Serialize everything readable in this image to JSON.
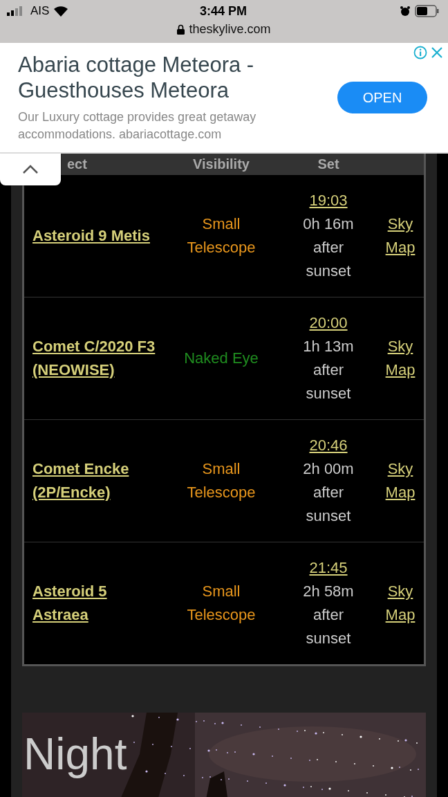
{
  "status_bar": {
    "carrier": "AIS",
    "time": "3:44 PM",
    "url": "theskylive.com"
  },
  "ad": {
    "title": "Abaria cottage Meteora - Guesthouses Meteora",
    "description": "Our Luxury cottage provides great getaway accommodations. abariacottage.com",
    "button": "OPEN"
  },
  "table": {
    "columns": [
      "ect",
      "Visibility",
      "Set"
    ],
    "rows": [
      {
        "object": "Asteroid 9 Metis",
        "visibility": "Small Telescope",
        "color": "#e8961c",
        "set_time": "19:03",
        "set_note": "0h 16m after sunset",
        "sky_map": "Sky Map"
      },
      {
        "object": "Comet C/2020 F3 (NEOWISE)",
        "visibility": "Naked Eye",
        "color": "#1f8c1f",
        "set_time": "20:00",
        "set_note": "1h 13m after sunset",
        "sky_map": "Sky Map"
      },
      {
        "object": "Comet Encke (2P/Encke)",
        "visibility": "Small Telescope",
        "color": "#e8961c",
        "set_time": "20:46",
        "set_note": "2h 00m after sunset",
        "sky_map": "Sky Map"
      },
      {
        "object": "Asteroid 5 Astraea",
        "visibility": "Small Telescope",
        "color": "#e8961c",
        "set_time": "21:45",
        "set_note": "2h 58m after sunset",
        "sky_map": "Sky Map"
      }
    ]
  },
  "night_section": {
    "title": "Night",
    "kind": "picture"
  }
}
